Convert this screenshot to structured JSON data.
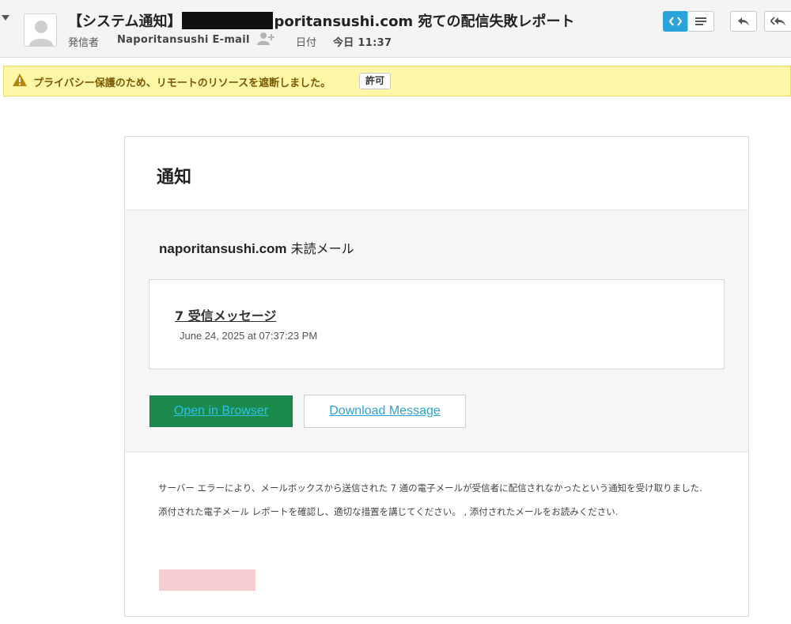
{
  "header": {
    "subject_prefix": "【システム通知】",
    "subject_suffix": "poritansushi.com 宛ての配信失敗レポート",
    "from_label": "発信者",
    "from_value": "Naporitansushi E-mail",
    "date_label": "日付",
    "date_value": "今日 11:37",
    "icons": [
      "collapse-arrow-icon",
      "avatar-icon",
      "add-contact-icon",
      "code-view-icon",
      "text-view-icon",
      "reply-icon",
      "reply-all-icon"
    ]
  },
  "privacy": {
    "message": "プライバシー保護のため、リモートのリソースを遮断しました。",
    "allow_label": "許可",
    "icon": "warning-icon"
  },
  "card": {
    "title": "通知",
    "unread_domain": "naporitansushi.com",
    "unread_suffix": " 未読メール",
    "message_count": "7 受信メッセージ",
    "message_date": "June 24, 2025 at 07:37:23 PM",
    "open_label": "Open in Browser",
    "download_label": "Download Message",
    "notice_1": "サーバー エラーにより、メールボックスから送信された 7 通の電子メールが受信者に配信されなかったという通知を受け取りました.",
    "notice_2": "添付された電子メール レポートを確認し、適切な措置を講じてください。 , 添付されたメールをお読みください."
  },
  "colors": {
    "open_button_bg": "#1b8a4c",
    "link": "#2aa3d8",
    "privacy_bg": "#fdf7a7",
    "redaction_block": "#111111",
    "pink_block": "#f8cdd0"
  }
}
